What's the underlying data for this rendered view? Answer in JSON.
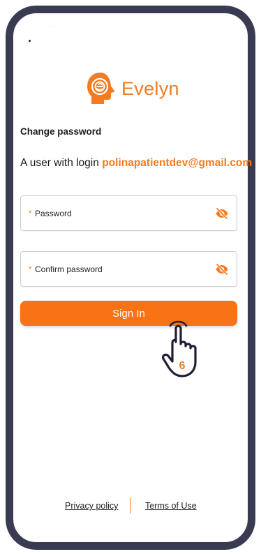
{
  "status_bar": {
    "text": "· · · ·"
  },
  "logo": {
    "name": "Evelyn",
    "icon": "head-profile-logo"
  },
  "form": {
    "title": "Change password",
    "login_prefix": "A user with login",
    "email": "polinapatientdev@gmail.com",
    "fields": [
      {
        "required_mark": "*",
        "label": "Password",
        "icon": "eye-slash-icon"
      },
      {
        "required_mark": "*",
        "label": "Confirm password",
        "icon": "eye-slash-icon"
      }
    ],
    "submit_label": "Sign In"
  },
  "annotation": {
    "step_number": "6",
    "icon": "pointing-hand-icon"
  },
  "footer": {
    "privacy_label": "Privacy policy",
    "terms_label": "Terms of Use"
  },
  "colors": {
    "accent": "#f47b20",
    "button": "#f97316",
    "frame": "#3a3a52"
  }
}
